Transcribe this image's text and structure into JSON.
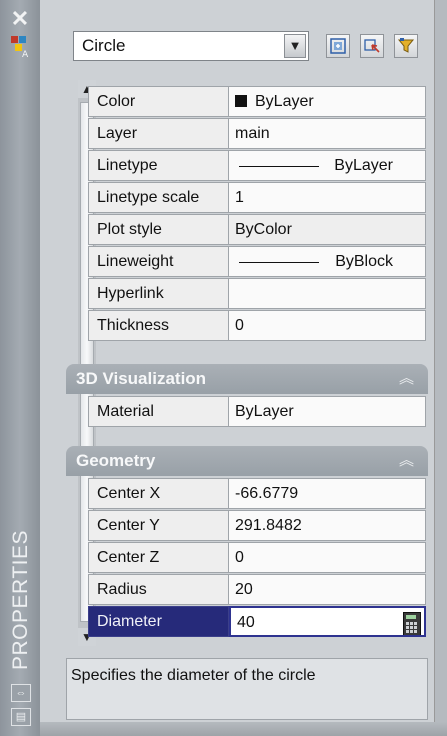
{
  "palette": {
    "title_bar": "#9aa1a8",
    "section": "#a2a9af",
    "selection": "#262a7a"
  },
  "title_bar": {
    "title": "PROPERTIES",
    "close_symbol": "✕",
    "icon": "properties-palette-icon",
    "buttons": [
      {
        "icon": "auto-hide-icon",
        "symbol": "⇔"
      },
      {
        "icon": "properties-menu-icon",
        "symbol": "▤"
      }
    ]
  },
  "selector": {
    "value": "Circle",
    "dropdown_icon": "chevron-down-icon",
    "tools": [
      {
        "icon": "toggle-pickadd-icon"
      },
      {
        "icon": "select-objects-icon"
      },
      {
        "icon": "quick-select-icon"
      }
    ]
  },
  "general": [
    {
      "label": "Color",
      "value": "ByLayer",
      "swatch": "#000000"
    },
    {
      "label": "Layer",
      "value": "main"
    },
    {
      "label": "Linetype",
      "value": "ByLayer",
      "line": true
    },
    {
      "label": "Linetype scale",
      "value": "1"
    },
    {
      "label": "Plot style",
      "value": "ByColor"
    },
    {
      "label": "Lineweight",
      "value": "ByBlock",
      "line": true
    },
    {
      "label": "Hyperlink",
      "value": ""
    },
    {
      "label": "Thickness",
      "value": "0"
    }
  ],
  "visualization": {
    "title": "3D Visualization",
    "rows": [
      {
        "label": "Material",
        "value": "ByLayer"
      }
    ]
  },
  "geometry": {
    "title": "Geometry",
    "rows": [
      {
        "label": "Center X",
        "value": "-66.6779"
      },
      {
        "label": "Center Y",
        "value": "291.8482"
      },
      {
        "label": "Center Z",
        "value": "0"
      },
      {
        "label": "Radius",
        "value": "20"
      },
      {
        "label": "Diameter",
        "value": "40"
      }
    ]
  },
  "description": "Specifies the diameter of the circle"
}
